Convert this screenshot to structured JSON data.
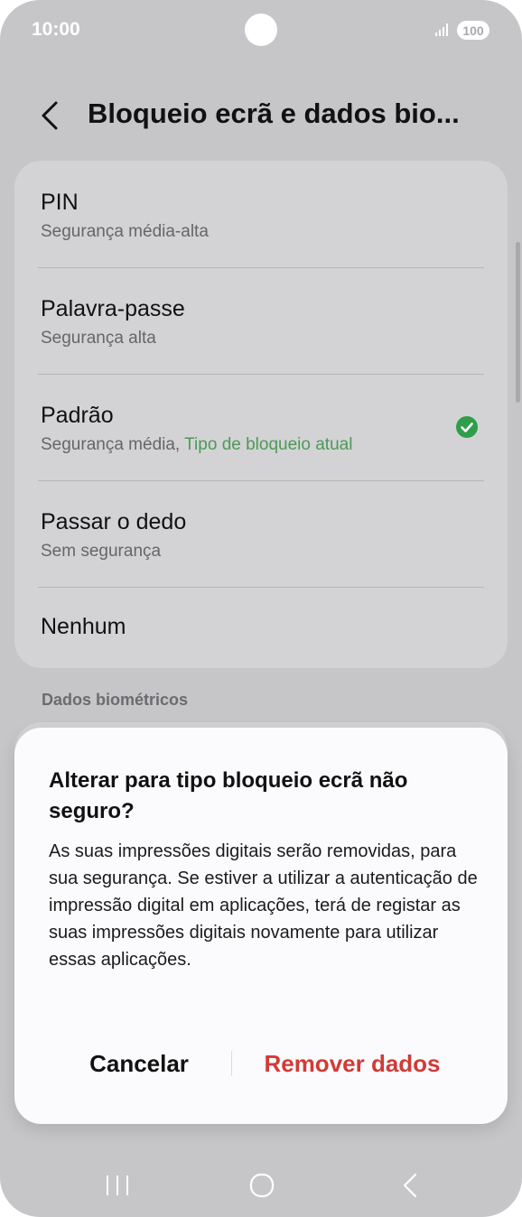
{
  "status_bar": {
    "time": "10:00",
    "battery": "100",
    "icons": [
      "signal-icon",
      "battery-icon"
    ]
  },
  "header": {
    "title": "Bloqueio ecrã e dados bio...",
    "back_icon": "back-chevron-icon"
  },
  "options": [
    {
      "title": "PIN",
      "subtitle": "Segurança média-alta"
    },
    {
      "title": "Palavra-passe",
      "subtitle": "Segurança alta"
    },
    {
      "title": "Padrão",
      "subtitle": "Segurança média,",
      "current_label": "Tipo de bloqueio atual",
      "selected": true
    },
    {
      "title": "Passar o dedo",
      "subtitle": "Sem segurança"
    },
    {
      "title": "Nenhum",
      "subtitle": ""
    }
  ],
  "section_header": "Dados biométricos",
  "dialog": {
    "title": "Alterar para tipo bloqueio ecrã não seguro?",
    "body": "As suas impressões digitais serão removidas, para sua segurança. Se estiver a utilizar a autenticação de impressão digital em aplicações, terá de registar as suas impressões digitais novamente para utilizar essas aplicações.",
    "cancel_label": "Cancelar",
    "remove_label": "Remover dados"
  },
  "nav_bar": {
    "icons": [
      "recent-apps-icon",
      "home-icon",
      "back-icon"
    ]
  },
  "colors": {
    "accent_green": "#4b9a57",
    "destructive_red": "#d13b36",
    "dim_background": "#c6c6c8"
  }
}
